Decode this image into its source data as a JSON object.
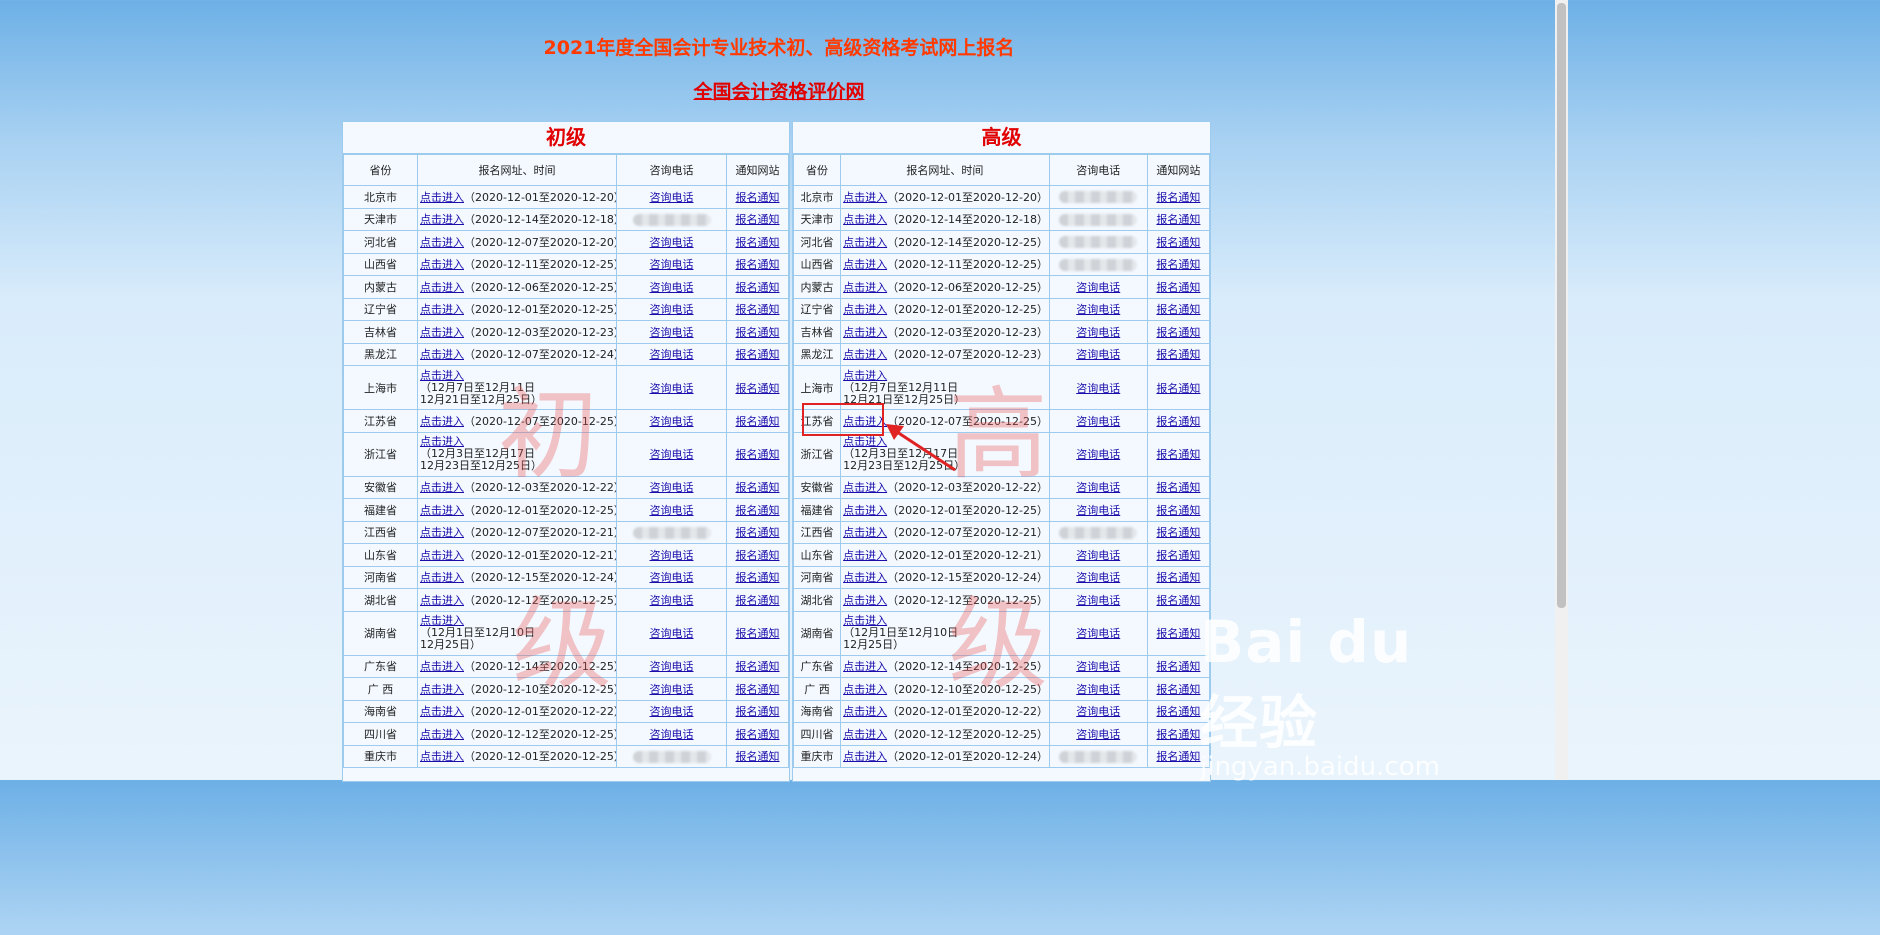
{
  "page": {
    "title": "2021年度全国会计专业技术初、高级资格考试网上报名",
    "subtitle_link": "全国会计资格评价网"
  },
  "columns": {
    "province": "省份",
    "url_time": "报名网址、时间",
    "phone": "咨询电话",
    "notice": "通知网站"
  },
  "basic": {
    "heading": "初级",
    "watermark_1": "初",
    "watermark_2": "级",
    "rows": [
      {
        "prov": "北京市",
        "link": "点击进入",
        "time": "（2020-12-01至2020-12-20）",
        "phone": "咨询电话",
        "notice": "报名通知"
      },
      {
        "prov": "天津市",
        "link": "点击进入",
        "time": "（2020-12-14至2020-12-18）",
        "phone": "",
        "notice": "报名通知",
        "blur": true
      },
      {
        "prov": "河北省",
        "link": "点击进入",
        "time": "（2020-12-07至2020-12-20）",
        "phone": "咨询电话",
        "notice": "报名通知"
      },
      {
        "prov": "山西省",
        "link": "点击进入",
        "time": "（2020-12-11至2020-12-25）",
        "phone": "咨询电话",
        "notice": "报名通知"
      },
      {
        "prov": "内蒙古",
        "link": "点击进入",
        "time": "（2020-12-06至2020-12-25）",
        "phone": "咨询电话",
        "notice": "报名通知"
      },
      {
        "prov": "辽宁省",
        "link": "点击进入",
        "time": "（2020-12-01至2020-12-25）",
        "phone": "咨询电话",
        "notice": "报名通知"
      },
      {
        "prov": "吉林省",
        "link": "点击进入",
        "time": "（2020-12-03至2020-12-23）",
        "phone": "咨询电话",
        "notice": "报名通知"
      },
      {
        "prov": "黑龙江",
        "link": "点击进入",
        "time": "（2020-12-07至2020-12-24）",
        "phone": "咨询电话",
        "notice": "报名通知"
      },
      {
        "prov": "上海市",
        "link": "点击进入",
        "time": "（12月7日至12月11日\n12月21日至12月25日）",
        "phone": "咨询电话",
        "notice": "报名通知",
        "multi": true
      },
      {
        "prov": "江苏省",
        "link": "点击进入",
        "time": "（2020-12-07至2020-12-25）",
        "phone": "咨询电话",
        "notice": "报名通知"
      },
      {
        "prov": "浙江省",
        "link": "点击进入",
        "time": "（12月3日至12月17日\n12月23日至12月25日）",
        "phone": "咨询电话",
        "notice": "报名通知",
        "multi": true
      },
      {
        "prov": "安徽省",
        "link": "点击进入",
        "time": "（2020-12-03至2020-12-22）",
        "phone": "咨询电话",
        "notice": "报名通知"
      },
      {
        "prov": "福建省",
        "link": "点击进入",
        "time": "（2020-12-01至2020-12-25）",
        "phone": "咨询电话",
        "notice": "报名通知"
      },
      {
        "prov": "江西省",
        "link": "点击进入",
        "time": "（2020-12-07至2020-12-21）",
        "phone": "",
        "notice": "报名通知",
        "blur": true
      },
      {
        "prov": "山东省",
        "link": "点击进入",
        "time": "（2020-12-01至2020-12-21）",
        "phone": "咨询电话",
        "notice": "报名通知"
      },
      {
        "prov": "河南省",
        "link": "点击进入",
        "time": "（2020-12-15至2020-12-24）",
        "phone": "咨询电话",
        "notice": "报名通知"
      },
      {
        "prov": "湖北省",
        "link": "点击进入",
        "time": "（2020-12-12至2020-12-25）",
        "phone": "咨询电话",
        "notice": "报名通知"
      },
      {
        "prov": "湖南省",
        "link": "点击进入",
        "time": "（12月1日至12月10日\n12月25日）",
        "phone": "咨询电话",
        "notice": "报名通知",
        "multi": true
      },
      {
        "prov": "广东省",
        "link": "点击进入",
        "time": "（2020-12-14至2020-12-25）",
        "phone": "咨询电话",
        "notice": "报名通知"
      },
      {
        "prov": "广 西",
        "link": "点击进入",
        "time": "（2020-12-10至2020-12-25）",
        "phone": "咨询电话",
        "notice": "报名通知"
      },
      {
        "prov": "海南省",
        "link": "点击进入",
        "time": "（2020-12-01至2020-12-22）",
        "phone": "咨询电话",
        "notice": "报名通知"
      },
      {
        "prov": "四川省",
        "link": "点击进入",
        "time": "（2020-12-12至2020-12-25）",
        "phone": "咨询电话",
        "notice": "报名通知"
      },
      {
        "prov": "重庆市",
        "link": "点击进入",
        "time": "（2020-12-01至2020-12-25）",
        "phone": "",
        "notice": "报名通知",
        "blur": true
      }
    ]
  },
  "senior": {
    "heading": "高级",
    "watermark_1": "高",
    "watermark_2": "级",
    "rows": [
      {
        "prov": "北京市",
        "link": "点击进入",
        "time": "（2020-12-01至2020-12-20）",
        "phone": "",
        "notice": "报名通知",
        "blur": true
      },
      {
        "prov": "天津市",
        "link": "点击进入",
        "time": "（2020-12-14至2020-12-18）",
        "phone": "",
        "notice": "报名通知",
        "blur": true
      },
      {
        "prov": "河北省",
        "link": "点击进入",
        "time": "（2020-12-14至2020-12-25）",
        "phone": "",
        "notice": "报名通知",
        "blur": true
      },
      {
        "prov": "山西省",
        "link": "点击进入",
        "time": "（2020-12-11至2020-12-25）",
        "phone": "",
        "notice": "报名通知",
        "blur": true
      },
      {
        "prov": "内蒙古",
        "link": "点击进入",
        "time": "（2020-12-06至2020-12-25）",
        "phone": "咨询电话",
        "notice": "报名通知"
      },
      {
        "prov": "辽宁省",
        "link": "点击进入",
        "time": "（2020-12-01至2020-12-25）",
        "phone": "咨询电话",
        "notice": "报名通知"
      },
      {
        "prov": "吉林省",
        "link": "点击进入",
        "time": "（2020-12-03至2020-12-23）",
        "phone": "咨询电话",
        "notice": "报名通知"
      },
      {
        "prov": "黑龙江",
        "link": "点击进入",
        "time": "（2020-12-07至2020-12-23）",
        "phone": "咨询电话",
        "notice": "报名通知"
      },
      {
        "prov": "上海市",
        "link": "点击进入",
        "time": "（12月7日至12月11日\n12月21日至12月25日）",
        "phone": "咨询电话",
        "notice": "报名通知",
        "multi": true
      },
      {
        "prov": "江苏省",
        "link": "点击进入",
        "time": "（2020-12-07至2020-12-25）",
        "phone": "咨询电话",
        "notice": "报名通知"
      },
      {
        "prov": "浙江省",
        "link": "点击进入",
        "time": "（12月3日至12月17日\n12月23日至12月25日）",
        "phone": "咨询电话",
        "notice": "报名通知",
        "multi": true
      },
      {
        "prov": "安徽省",
        "link": "点击进入",
        "time": "（2020-12-03至2020-12-22）",
        "phone": "咨询电话",
        "notice": "报名通知"
      },
      {
        "prov": "福建省",
        "link": "点击进入",
        "time": "（2020-12-01至2020-12-25）",
        "phone": "咨询电话",
        "notice": "报名通知"
      },
      {
        "prov": "江西省",
        "link": "点击进入",
        "time": "（2020-12-07至2020-12-21）",
        "phone": "",
        "notice": "报名通知",
        "blur": true
      },
      {
        "prov": "山东省",
        "link": "点击进入",
        "time": "（2020-12-01至2020-12-21）",
        "phone": "咨询电话",
        "notice": "报名通知"
      },
      {
        "prov": "河南省",
        "link": "点击进入",
        "time": "（2020-12-15至2020-12-24）",
        "phone": "咨询电话",
        "notice": "报名通知"
      },
      {
        "prov": "湖北省",
        "link": "点击进入",
        "time": "（2020-12-12至2020-12-25）",
        "phone": "咨询电话",
        "notice": "报名通知"
      },
      {
        "prov": "湖南省",
        "link": "点击进入",
        "time": "（12月1日至12月10日\n12月25日）",
        "phone": "咨询电话",
        "notice": "报名通知",
        "multi": true
      },
      {
        "prov": "广东省",
        "link": "点击进入",
        "time": "（2020-12-14至2020-12-25）",
        "phone": "咨询电话",
        "notice": "报名通知"
      },
      {
        "prov": "广 西",
        "link": "点击进入",
        "time": "（2020-12-10至2020-12-25）",
        "phone": "咨询电话",
        "notice": "报名通知"
      },
      {
        "prov": "海南省",
        "link": "点击进入",
        "time": "（2020-12-01至2020-12-22）",
        "phone": "咨询电话",
        "notice": "报名通知"
      },
      {
        "prov": "四川省",
        "link": "点击进入",
        "time": "（2020-12-12至2020-12-25）",
        "phone": "咨询电话",
        "notice": "报名通知"
      },
      {
        "prov": "重庆市",
        "link": "点击进入",
        "time": "（2020-12-01至2020-12-24）",
        "phone": "",
        "notice": "报名通知",
        "blur": true
      }
    ]
  },
  "logo": {
    "brand": "Bai du 经验",
    "url": "jingyan.baidu.com"
  },
  "colors": {
    "title": "#ff3a00",
    "heading": "#e10000",
    "link": "#1a0dab",
    "highlight": "#e12222"
  }
}
